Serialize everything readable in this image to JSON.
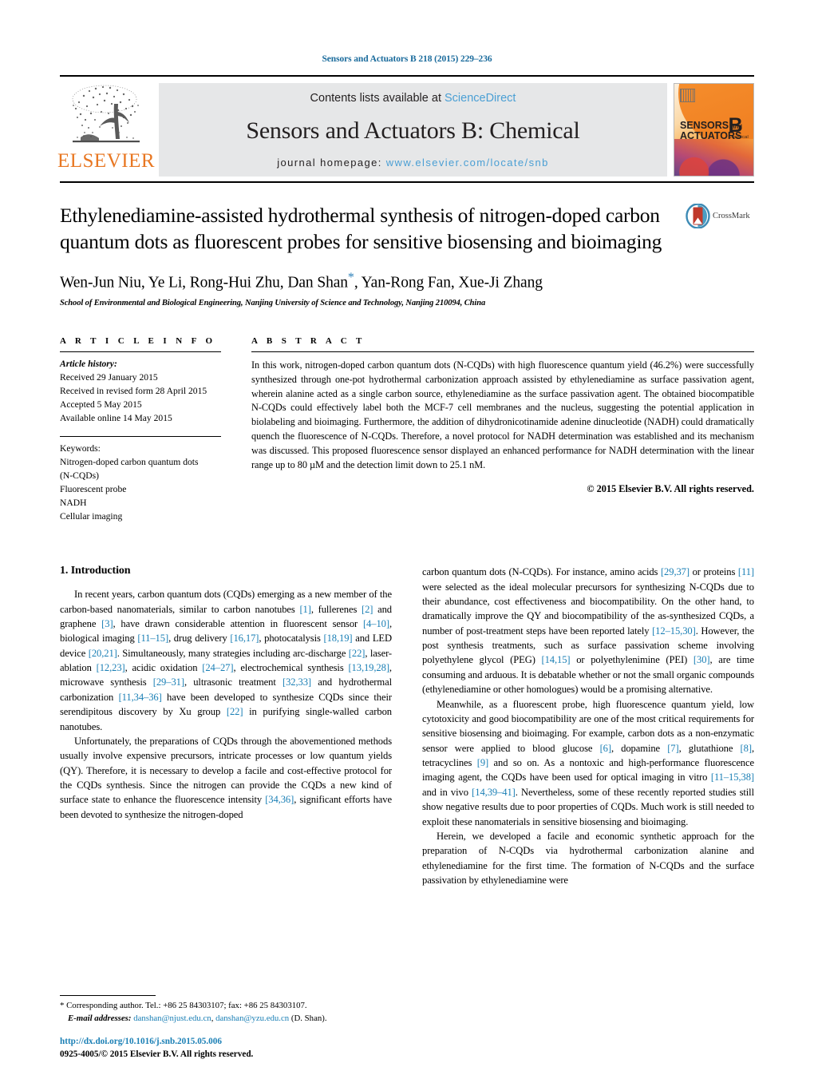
{
  "running_head": "Sensors and Actuators B 218 (2015) 229–236",
  "banner": {
    "publisher_name": "ELSEVIER",
    "contents_prefix": "Contents lists available at ",
    "contents_link": "ScienceDirect",
    "journal_title": "Sensors and Actuators B: Chemical",
    "homepage_prefix": "journal homepage: ",
    "homepage_url": "www.elsevier.com/locate/snb",
    "cover": {
      "line1": "SENSORS",
      "line1_small": "and",
      "line2": "ACTUATORS",
      "letter": "B",
      "letter_sub": "Chemical"
    },
    "link_color": "#4a9fd4"
  },
  "article": {
    "title": "Ethylenediamine-assisted hydrothermal synthesis of nitrogen-doped carbon quantum dots as fluorescent probes for sensitive biosensing and bioimaging",
    "crossmark_label": "CrossMark",
    "authors": "Wen-Jun Niu, Ye Li, Rong-Hui Zhu, Dan Shan",
    "authors_tail": ", Yan-Rong Fan, Xue-Ji Zhang",
    "corresponding_marker": "*",
    "affiliation": "School of Environmental and Biological Engineering, Nanjing University of Science and Technology, Nanjing 210094, China"
  },
  "article_info": {
    "heading": "A R T I C L E    I N F O",
    "history_label": "Article history:",
    "history": [
      "Received 29 January 2015",
      "Received in revised form 28 April 2015",
      "Accepted 5 May 2015",
      "Available online 14 May 2015"
    ],
    "keywords_label": "Keywords:",
    "keywords": [
      "Nitrogen-doped carbon quantum dots",
      "(N-CQDs)",
      "Fluorescent probe",
      "NADH",
      "Cellular imaging"
    ]
  },
  "abstract": {
    "heading": "A B S T R A C T",
    "text": "In this work, nitrogen-doped carbon quantum dots (N-CQDs) with high fluorescence quantum yield (46.2%) were successfully synthesized through one-pot hydrothermal carbonization approach assisted by ethylenediamine as surface passivation agent, wherein alanine acted as a single carbon source, ethylenediamine as the surface passivation agent. The obtained biocompatible N-CQDs could effectively label both the MCF-7 cell membranes and the nucleus, suggesting the potential application in biolabeling and bioimaging. Furthermore, the addition of dihydronicotinamide adenine dinucleotide (NADH) could dramatically quench the fluorescence of N-CQDs. Therefore, a novel protocol for NADH determination was established and its mechanism was discussed. This proposed fluorescence sensor displayed an enhanced performance for NADH determination with the linear range up to 80 µM and the detection limit down to 25.1 nM.",
    "copyright": "© 2015 Elsevier B.V. All rights reserved."
  },
  "body": {
    "section_number_title": "1.  Introduction",
    "left_paragraphs": [
      "In recent years, carbon quantum dots (CQDs) emerging as a new member of the carbon-based nanomaterials, similar to carbon nanotubes [1], fullerenes [2] and graphene [3], have drawn considerable attention in fluorescent sensor [4–10], biological imaging [11–15], drug delivery [16,17], photocatalysis [18,19] and LED device [20,21]. Simultaneously, many strategies including arc-discharge [22], laser-ablation [12,23], acidic oxidation [24–27], electrochemical synthesis [13,19,28], microwave synthesis [29–31], ultrasonic treatment [32,33] and hydrothermal carbonization [11,34–36] have been developed to synthesize CQDs since their serendipitous discovery by Xu group [22] in purifying single-walled carbon nanotubes.",
      "Unfortunately, the preparations of CQDs through the abovementioned methods usually involve expensive precursors, intricate processes or low quantum yields (QY). Therefore, it is necessary to develop a facile and cost-effective protocol for the CQDs synthesis. Since the nitrogen can provide the CQDs a new kind of surface state to enhance the fluorescence intensity [34,36], significant efforts have been devoted to synthesize the nitrogen-doped"
    ],
    "right_paragraphs": [
      "carbon quantum dots (N-CQDs). For instance, amino acids [29,37] or proteins [11] were selected as the ideal molecular precursors for synthesizing N-CQDs due to their abundance, cost effectiveness and biocompatibility. On the other hand, to dramatically improve the QY and biocompatibility of the as-synthesized CQDs, a number of post-treatment steps have been reported lately [12–15,30]. However, the post synthesis treatments, such as surface passivation scheme involving polyethylene glycol (PEG) [14,15] or polyethylenimine (PEI) [30], are time consuming and arduous. It is debatable whether or not the small organic compounds (ethylenediamine or other homologues) would be a promising alternative.",
      "Meanwhile, as a fluorescent probe, high fluorescence quantum yield, low cytotoxicity and good biocompatibility are one of the most critical requirements for sensitive biosensing and bioimaging. For example, carbon dots as a non-enzymatic sensor were applied to blood glucose [6], dopamine [7], glutathione [8], tetracyclines [9] and so on. As a nontoxic and high-performance fluorescence imaging agent, the CQDs have been used for optical imaging in vitro [11–15,38] and in vivo [14,39–41]. Nevertheless, some of these recently reported studies still show negative results due to poor properties of CQDs. Much work is still needed to exploit these nanomaterials in sensitive biosensing and bioimaging.",
      "Herein, we developed a facile and economic synthetic approach for the preparation of N-CQDs via hydrothermal carbonization alanine and ethylenediamine for the first time. The formation of N-CQDs and the surface passivation by ethylenediamine were"
    ]
  },
  "footnotes": {
    "corresponding": "* Corresponding author. Tel.: +86 25 84303107; fax: +86 25 84303107.",
    "email_label": "E-mail addresses:",
    "email1": "danshan@njust.edu.cn",
    "email_sep": ", ",
    "email2": "danshan@yzu.edu.cn",
    "email_tail": " (D. Shan).",
    "doi": "http://dx.doi.org/10.1016/j.snb.2015.05.006",
    "issn_line": "0925-4005/© 2015 Elsevier B.V. All rights reserved."
  }
}
